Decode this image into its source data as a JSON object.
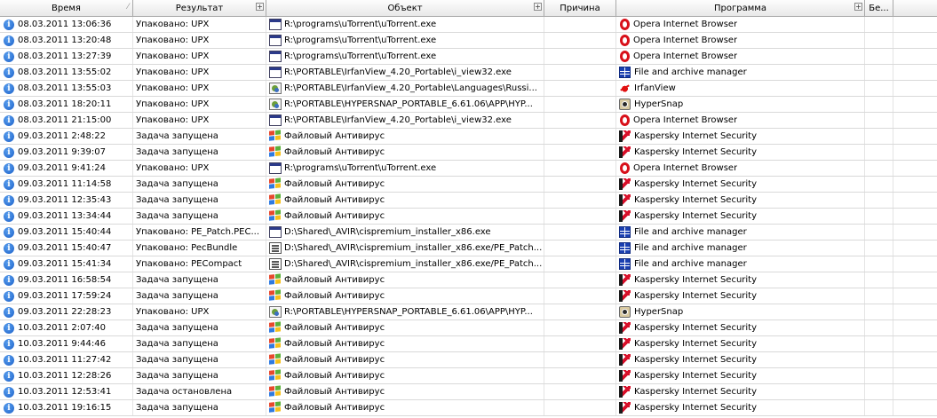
{
  "header": {
    "columns": [
      {
        "key": "time",
        "label": "Время"
      },
      {
        "key": "result",
        "label": "Результат"
      },
      {
        "key": "object",
        "label": "Объект"
      },
      {
        "key": "reason",
        "label": "Причина"
      },
      {
        "key": "program",
        "label": "Программа"
      },
      {
        "key": "be",
        "label": "Бе..."
      }
    ]
  },
  "icons": {
    "info": "info-icon",
    "exe": "executable-file-icon",
    "res": "resource-file-icon",
    "pkg": "package-file-icon",
    "win": "windows-flag-icon",
    "opera": "opera-icon",
    "fam": "file-archive-manager-icon",
    "irfan": "irfanview-icon",
    "hyper": "hypersnap-icon",
    "kis": "kaspersky-icon"
  },
  "colors": {
    "info": "#1a5fc8",
    "opera": "#d8101a",
    "kaspersky": "#d8102a"
  },
  "rows": [
    {
      "time": "08.03.2011 13:06:36",
      "result": "Упаковано: UPX",
      "obj_icon": "exe",
      "object": "R:\\programs\\uTorrent\\uTorrent.exe",
      "reason": "",
      "prog_icon": "opera",
      "program": "Opera Internet Browser"
    },
    {
      "time": "08.03.2011 13:20:48",
      "result": "Упаковано: UPX",
      "obj_icon": "exe",
      "object": "R:\\programs\\uTorrent\\uTorrent.exe",
      "reason": "",
      "prog_icon": "opera",
      "program": "Opera Internet Browser"
    },
    {
      "time": "08.03.2011 13:27:39",
      "result": "Упаковано: UPX",
      "obj_icon": "exe",
      "object": "R:\\programs\\uTorrent\\uTorrent.exe",
      "reason": "",
      "prog_icon": "opera",
      "program": "Opera Internet Browser"
    },
    {
      "time": "08.03.2011 13:55:02",
      "result": "Упаковано: UPX",
      "obj_icon": "exe",
      "object": "R:\\PORTABLE\\IrfanView_4.20_Portable\\i_view32.exe",
      "reason": "",
      "prog_icon": "fam",
      "program": "File and archive manager"
    },
    {
      "time": "08.03.2011 13:55:03",
      "result": "Упаковано: UPX",
      "obj_icon": "res",
      "object": "R:\\PORTABLE\\IrfanView_4.20_Portable\\Languages\\Russi...",
      "reason": "",
      "prog_icon": "irfan",
      "program": "IrfanView"
    },
    {
      "time": "08.03.2011 18:20:11",
      "result": "Упаковано: UPX",
      "obj_icon": "res",
      "object": "R:\\PORTABLE\\HYPERSNAP_PORTABLE_6.61.06\\APP\\HYP...",
      "reason": "",
      "prog_icon": "hyper",
      "program": "HyperSnap"
    },
    {
      "time": "08.03.2011 21:15:00",
      "result": "Упаковано: UPX",
      "obj_icon": "exe",
      "object": "R:\\PORTABLE\\IrfanView_4.20_Portable\\i_view32.exe",
      "reason": "",
      "prog_icon": "opera",
      "program": "Opera Internet Browser"
    },
    {
      "time": "09.03.2011 2:48:22",
      "result": "Задача запущена",
      "obj_icon": "win",
      "object": "Файловый Антивирус",
      "reason": "",
      "prog_icon": "kis",
      "program": "Kaspersky Internet Security"
    },
    {
      "time": "09.03.2011 9:39:07",
      "result": "Задача запущена",
      "obj_icon": "win",
      "object": "Файловый Антивирус",
      "reason": "",
      "prog_icon": "kis",
      "program": "Kaspersky Internet Security"
    },
    {
      "time": "09.03.2011 9:41:24",
      "result": "Упаковано: UPX",
      "obj_icon": "exe",
      "object": "R:\\programs\\uTorrent\\uTorrent.exe",
      "reason": "",
      "prog_icon": "opera",
      "program": "Opera Internet Browser"
    },
    {
      "time": "09.03.2011 11:14:58",
      "result": "Задача запущена",
      "obj_icon": "win",
      "object": "Файловый Антивирус",
      "reason": "",
      "prog_icon": "kis",
      "program": "Kaspersky Internet Security"
    },
    {
      "time": "09.03.2011 12:35:43",
      "result": "Задача запущена",
      "obj_icon": "win",
      "object": "Файловый Антивирус",
      "reason": "",
      "prog_icon": "kis",
      "program": "Kaspersky Internet Security"
    },
    {
      "time": "09.03.2011 13:34:44",
      "result": "Задача запущена",
      "obj_icon": "win",
      "object": "Файловый Антивирус",
      "reason": "",
      "prog_icon": "kis",
      "program": "Kaspersky Internet Security"
    },
    {
      "time": "09.03.2011 15:40:44",
      "result": "Упаковано: PE_Patch.PEC...",
      "obj_icon": "exe",
      "object": "D:\\Shared\\_AVIR\\cispremium_installer_x86.exe",
      "reason": "",
      "prog_icon": "fam",
      "program": "File and archive manager"
    },
    {
      "time": "09.03.2011 15:40:47",
      "result": "Упаковано: PecBundle",
      "obj_icon": "pkg",
      "object": "D:\\Shared\\_AVIR\\cispremium_installer_x86.exe/PE_Patch...",
      "reason": "",
      "prog_icon": "fam",
      "program": "File and archive manager"
    },
    {
      "time": "09.03.2011 15:41:34",
      "result": "Упаковано: PECompact",
      "obj_icon": "pkg",
      "object": "D:\\Shared\\_AVIR\\cispremium_installer_x86.exe/PE_Patch...",
      "reason": "",
      "prog_icon": "fam",
      "program": "File and archive manager"
    },
    {
      "time": "09.03.2011 16:58:54",
      "result": "Задача запущена",
      "obj_icon": "win",
      "object": "Файловый Антивирус",
      "reason": "",
      "prog_icon": "kis",
      "program": "Kaspersky Internet Security"
    },
    {
      "time": "09.03.2011 17:59:24",
      "result": "Задача запущена",
      "obj_icon": "win",
      "object": "Файловый Антивирус",
      "reason": "",
      "prog_icon": "kis",
      "program": "Kaspersky Internet Security"
    },
    {
      "time": "09.03.2011 22:28:23",
      "result": "Упаковано: UPX",
      "obj_icon": "res",
      "object": "R:\\PORTABLE\\HYPERSNAP_PORTABLE_6.61.06\\APP\\HYP...",
      "reason": "",
      "prog_icon": "hyper",
      "program": "HyperSnap"
    },
    {
      "time": "10.03.2011 2:07:40",
      "result": "Задача запущена",
      "obj_icon": "win",
      "object": "Файловый Антивирус",
      "reason": "",
      "prog_icon": "kis",
      "program": "Kaspersky Internet Security"
    },
    {
      "time": "10.03.2011 9:44:46",
      "result": "Задача запущена",
      "obj_icon": "win",
      "object": "Файловый Антивирус",
      "reason": "",
      "prog_icon": "kis",
      "program": "Kaspersky Internet Security"
    },
    {
      "time": "10.03.2011 11:27:42",
      "result": "Задача запущена",
      "obj_icon": "win",
      "object": "Файловый Антивирус",
      "reason": "",
      "prog_icon": "kis",
      "program": "Kaspersky Internet Security"
    },
    {
      "time": "10.03.2011 12:28:26",
      "result": "Задача запущена",
      "obj_icon": "win",
      "object": "Файловый Антивирус",
      "reason": "",
      "prog_icon": "kis",
      "program": "Kaspersky Internet Security"
    },
    {
      "time": "10.03.2011 12:53:41",
      "result": "Задача остановлена",
      "obj_icon": "win",
      "object": "Файловый Антивирус",
      "reason": "",
      "prog_icon": "kis",
      "program": "Kaspersky Internet Security"
    },
    {
      "time": "10.03.2011 19:16:15",
      "result": "Задача запущена",
      "obj_icon": "win",
      "object": "Файловый Антивирус",
      "reason": "",
      "prog_icon": "kis",
      "program": "Kaspersky Internet Security"
    }
  ]
}
